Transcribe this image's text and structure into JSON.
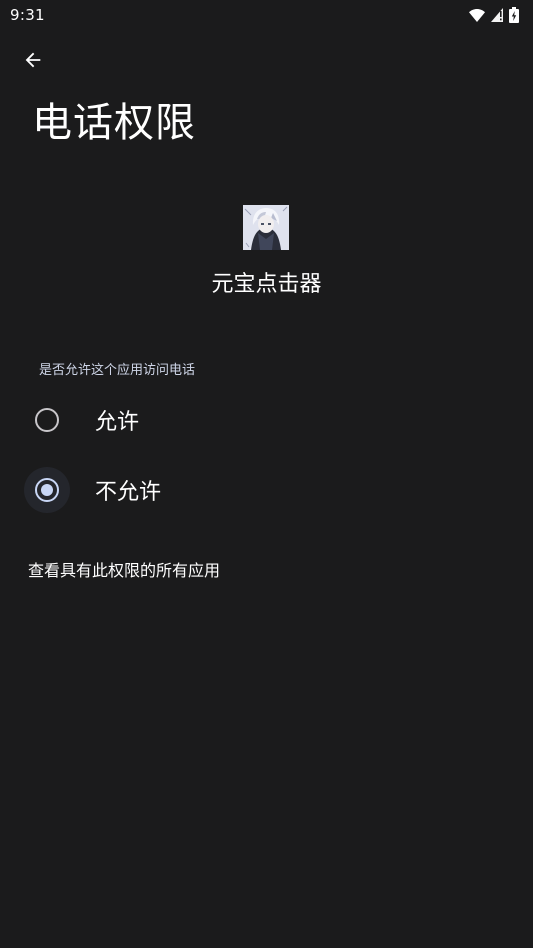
{
  "status_bar": {
    "time": "9:31",
    "icons": [
      "wifi-icon",
      "signal-icon",
      "battery-charging-icon"
    ]
  },
  "header": {
    "back_icon": "arrow-back-icon",
    "title": "电话权限"
  },
  "app": {
    "name": "元宝点击器"
  },
  "permission": {
    "question": "是否允许这个应用访问电话",
    "options": [
      {
        "label": "允许",
        "selected": false
      },
      {
        "label": "不允许",
        "selected": true
      }
    ],
    "view_all_link": "查看具有此权限的所有应用"
  },
  "colors": {
    "background": "#1b1b1c",
    "accent": "#c8d6f5",
    "text": "#ffffff"
  }
}
